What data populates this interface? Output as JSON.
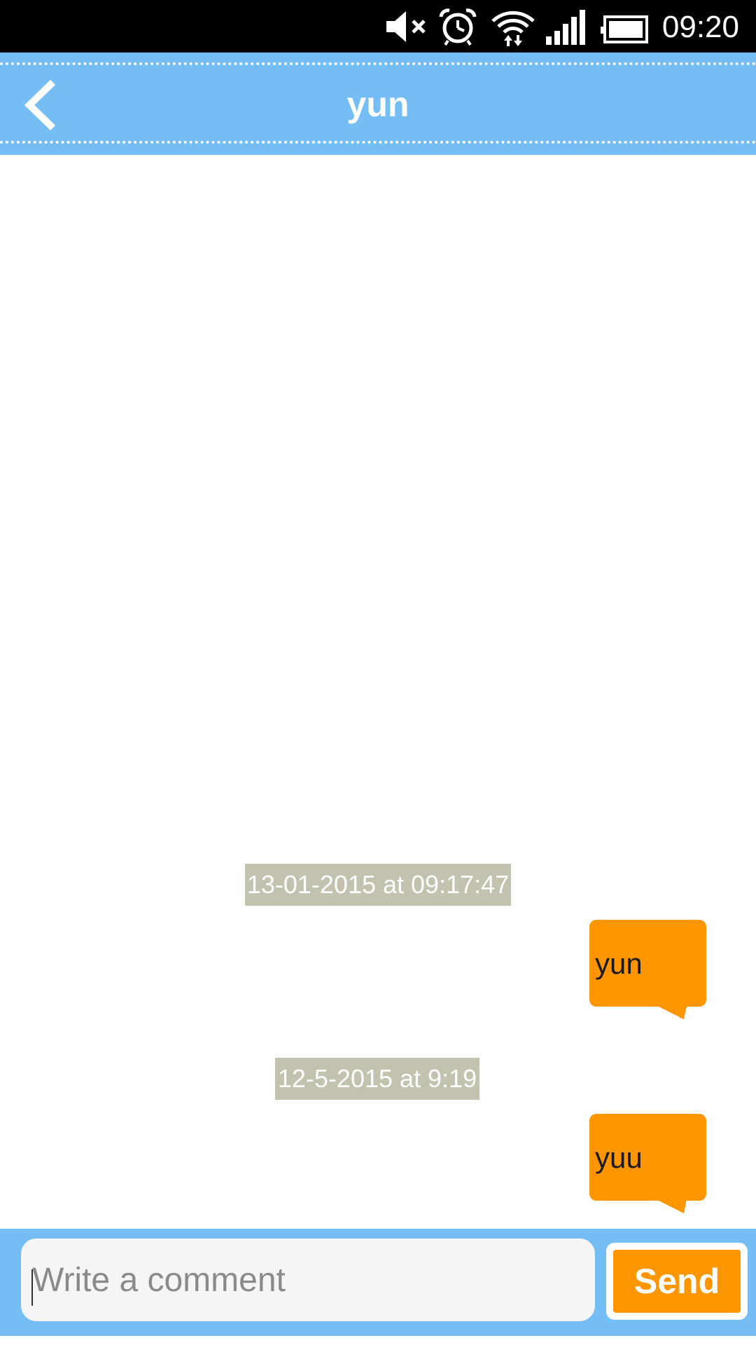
{
  "status_bar": {
    "time": "09:20",
    "icons": [
      "mute-icon",
      "alarm-icon",
      "wifi-icon",
      "signal-icon",
      "battery-icon"
    ]
  },
  "header": {
    "title": "yun",
    "back_icon": "chevron-left-icon",
    "background_color": "#74bdf5"
  },
  "messages": [
    {
      "timestamp": "13-01-2015 at 09:17:47",
      "text": "yun"
    },
    {
      "timestamp": "12-5-2015 at 9:19",
      "text": "yuu"
    }
  ],
  "composer": {
    "placeholder": "Write a comment",
    "value": "",
    "send_label": "Send"
  },
  "colors": {
    "accent": "#fd9601",
    "timestamp_bg": "#c3c2af",
    "bar_blue": "#74bdf5"
  }
}
